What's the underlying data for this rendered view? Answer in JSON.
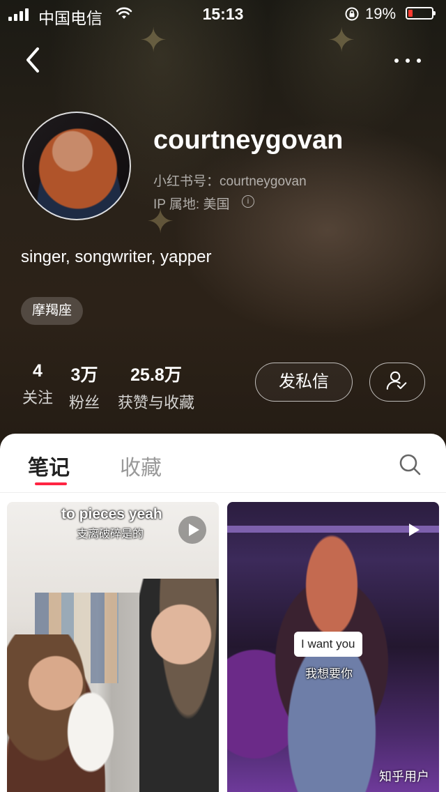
{
  "status_bar": {
    "carrier": "中国电信",
    "time": "15:13",
    "battery_percent": "19%",
    "battery_level": 0.19,
    "battery_color": "#ff3b30"
  },
  "nav": {
    "back_icon": "chevron-left-icon",
    "more_icon": "ellipsis-icon"
  },
  "profile": {
    "username": "courtneygovan",
    "redbook_id": "小红书号：courtneygovan",
    "ip_location": "IP 属地: 美国",
    "bio": "singer, songwriter, yapper",
    "tag": "摩羯座",
    "stats": [
      {
        "value": "4",
        "label": "关注"
      },
      {
        "value": "3万",
        "label": "粉丝"
      },
      {
        "value": "25.8万",
        "label": "获赞与收藏"
      }
    ],
    "dm_button": "发私信",
    "follow_icon": "user-check-icon"
  },
  "tabs": {
    "notes": "笔记",
    "collections": "收藏",
    "active": "notes",
    "accent": "#ff2442"
  },
  "feed": [
    {
      "caption_en": "to pieces yeah",
      "caption_zh": "支离破碎是的"
    },
    {
      "subtitle_en": "I want you",
      "subtitle_zh": "我想要你"
    }
  ],
  "watermark": "知乎用户"
}
